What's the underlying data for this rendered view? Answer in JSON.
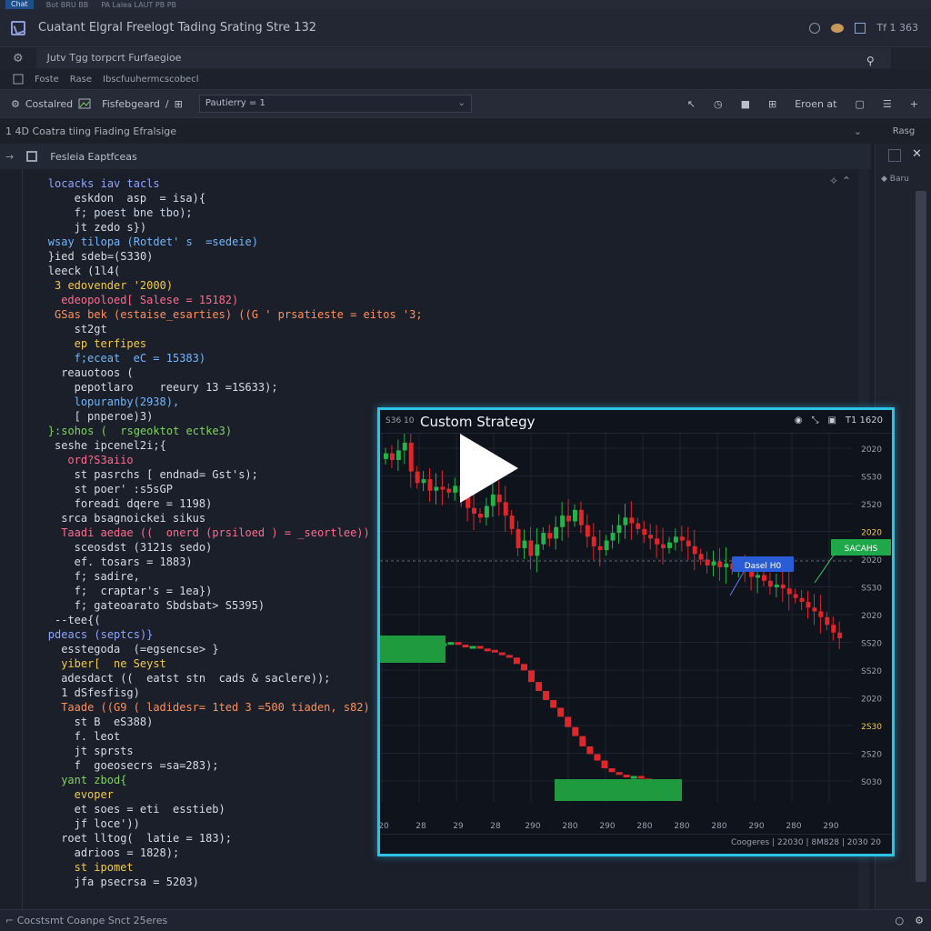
{
  "top_strip": {
    "items": [
      "Chat",
      "Bot BRU BB",
      "PA Lalea LAUT PB PB"
    ]
  },
  "window": {
    "title": "Cuatant Elgral Freelogt Tading Srating Stre 132",
    "right_label": "Tf 1 363"
  },
  "search_bar": {
    "value": "Jutv Tgg torpcrt  Furfaegioe"
  },
  "menu_row": {
    "items": [
      "Foste",
      "Rase",
      "Ibscfuuhermcscobecl"
    ]
  },
  "toolbar": {
    "item1": "Costalred",
    "item2": "Fisfebgeard",
    "select_value": "Pautierry = 1",
    "right_label": "Eroen at"
  },
  "section_header": {
    "label": "1 4D Coatra tiing Fiading Efralsige",
    "side_label": "Rasg"
  },
  "subheader": {
    "label": "Fesleia Eaptfceas"
  },
  "sidebar": {
    "label": "Baru"
  },
  "status_bar": {
    "label": "Cocstsmt Coanpe Snct 25eres"
  },
  "code": {
    "lines": [
      {
        "t": "locacks iav tacls",
        "c": "#8fa4ff",
        "i": 4
      },
      {
        "t": "eskdon  asp  = isa){",
        "c": "#d7dbe4",
        "i": 8
      },
      {
        "t": "f; poest bne tbo);",
        "c": "#c9d4e6",
        "i": 8
      },
      {
        "t": "jt zedo s})",
        "c": "#d7dbe4",
        "i": 8
      },
      {
        "t": "wsay tilopa (Rotdet' s  =sedeie)",
        "c": "#6fb7ff",
        "i": 4
      },
      {
        "t": "}ied sdeb=(S330)",
        "c": "#d7dbe4",
        "i": 4
      },
      {
        "t": "leeck (1l4(",
        "c": "#d7dbe4",
        "i": 4
      },
      {
        "t": "3 edovender '2000)",
        "c": "#f2c94c",
        "i": 5
      },
      {
        "t": "edeopoloed[ Salese = 15182)",
        "c": "#ff6a8c",
        "i": 6
      },
      {
        "t": "GSas bek (estaise_esarties) ((G ' prsatieste = eitos '3;",
        "c": "#ff8f5a",
        "i": 5
      },
      {
        "t": "st2gt",
        "c": "#d7dbe4",
        "i": 8
      },
      {
        "t": "ep terfipes",
        "c": "#f2c94c",
        "i": 8
      },
      {
        "t": "f;eceat  eC = 15383)",
        "c": "#6fb7ff",
        "i": 8
      },
      {
        "t": "reauotoos (",
        "c": "#d7dbe4",
        "i": 6
      },
      {
        "t": "pepotlaro    reeury 13 =1S633);",
        "c": "#d7dbe4",
        "i": 8
      },
      {
        "t": "lopuranby(2938),",
        "c": "#6fb7ff",
        "i": 8
      },
      {
        "t": "[ pnperoe)3)",
        "c": "#d7dbe4",
        "i": 8
      },
      {
        "t": "}:sohos (  rsgeoktot ectke3)",
        "c": "#7fd35f",
        "i": 4
      },
      {
        "t": "seshe ipcenel2i;{",
        "c": "#d7dbe4",
        "i": 5
      },
      {
        "t": "ord?S3aiio",
        "c": "#ff6a8c",
        "i": 7
      },
      {
        "t": "st pasrchs [ endnad= Gst's);",
        "c": "#d7dbe4",
        "i": 8
      },
      {
        "t": "st poer' :s5sGP",
        "c": "#d7dbe4",
        "i": 8
      },
      {
        "t": "foreadi dqere = 1198)",
        "c": "#d7dbe4",
        "i": 8
      },
      {
        "t": "srca bsagnoickei sikus",
        "c": "#d7dbe4",
        "i": 6
      },
      {
        "t": "Taadi aedae ((  onerd (prsiloed ) = _seortlee))",
        "c": "#ff6a8c",
        "i": 6
      },
      {
        "t": "sceosdst (3121s sedo)",
        "c": "#d7dbe4",
        "i": 8
      },
      {
        "t": "ef. tosars = 1883)",
        "c": "#d7dbe4",
        "i": 8
      },
      {
        "t": "f; sadire,",
        "c": "#d7dbe4",
        "i": 8
      },
      {
        "t": "f;  craptar's = 1ea})",
        "c": "#d7dbe4",
        "i": 8
      },
      {
        "t": "f; gateoarato Sbdsbat> S5395)",
        "c": "#d7dbe4",
        "i": 8
      },
      {
        "t": "--tee{(",
        "c": "#d7dbe4",
        "i": 5
      },
      {
        "t": "pdeacs (septcs)}",
        "c": "#8fa4ff",
        "i": 4
      },
      {
        "t": "esstegoda  (=egsencse> }",
        "c": "#d7dbe4",
        "i": 6
      },
      {
        "t": "yiber[  ne Seyst",
        "c": "#f2c94c",
        "i": 6
      },
      {
        "t": "adesdact ((  eatst stn  cads & saclere));",
        "c": "#d7dbe4",
        "i": 6
      },
      {
        "t": "1 dSfesfisg)",
        "c": "#d7dbe4",
        "i": 6
      },
      {
        "t": "Taade ((G9 ( ladidesr= 1ted 3 =500 tiaden, s82)",
        "c": "#ff8f5a",
        "i": 6
      },
      {
        "t": "st B  eS388)",
        "c": "#d7dbe4",
        "i": 8
      },
      {
        "t": "f. leot",
        "c": "#d7dbe4",
        "i": 8
      },
      {
        "t": "jt sprsts",
        "c": "#d7dbe4",
        "i": 8
      },
      {
        "t": "f  goeosecrs =sa=283);",
        "c": "#d7dbe4",
        "i": 8
      },
      {
        "t": "yant zbod{",
        "c": "#7fd35f",
        "i": 6
      },
      {
        "t": "evoper",
        "c": "#f2c94c",
        "i": 8
      },
      {
        "t": "et soes = eti  esstieb)",
        "c": "#d7dbe4",
        "i": 8
      },
      {
        "t": "jf loce'))",
        "c": "#d7dbe4",
        "i": 8
      },
      {
        "t": "roet lltog(  latie = 183);",
        "c": "#d7dbe4",
        "i": 6
      },
      {
        "t": "adrioos = 1828);",
        "c": "#d7dbe4",
        "i": 8
      },
      {
        "t": "st ipomet",
        "c": "#f2c94c",
        "i": 8
      },
      {
        "t": "jfa psecrsa = 5203)",
        "c": "#d7dbe4",
        "i": 8
      }
    ]
  },
  "chart_window": {
    "small_label": "S36 10",
    "title": "Custom Strategy",
    "header_right": "T1 1620",
    "footer_label": "Coogeres  |  22030  |  8M828  |  2030  20"
  },
  "chart_data": {
    "type": "candlestick",
    "title": "Custom Strategy",
    "y_tick_labels": [
      "2020",
      "SS30",
      "2520",
      "2020",
      "2020",
      "SS30",
      "2020",
      "SS20",
      "SS20",
      "2020",
      "2S30",
      "2S20",
      "S030"
    ],
    "highlighted_y_tick_index": 3,
    "x_tick_labels": [
      "20",
      "28",
      "29",
      "28",
      "290",
      "280",
      "290",
      "280",
      "280",
      "280",
      "290",
      "280",
      "290"
    ],
    "annotations": [
      {
        "label": "Dasel H0",
        "color": "#2a5cd6"
      },
      {
        "label": "SACAHS",
        "color": "#1fa84a"
      }
    ],
    "up_color": "#25b24a",
    "down_color": "#e0252b",
    "price_series": [
      21,
      28,
      18,
      10,
      40,
      52,
      48,
      60,
      56,
      58,
      62,
      55,
      66,
      78,
      84,
      88,
      76,
      64,
      72,
      86,
      100,
      120,
      112,
      128,
      116,
      104,
      110,
      98,
      86,
      92,
      80,
      96,
      108,
      118,
      122,
      112,
      104,
      96,
      88,
      94,
      100,
      106,
      110,
      116,
      120,
      114,
      108,
      112,
      118,
      126,
      132,
      138,
      134,
      140,
      136,
      142,
      138,
      144,
      150,
      148,
      154,
      160,
      158,
      162,
      168,
      172,
      176,
      182,
      186,
      192,
      200,
      208,
      214
    ],
    "lower_series": [
      250,
      252,
      255,
      254,
      256,
      258,
      260,
      262,
      258,
      256,
      260,
      264,
      262,
      266,
      268,
      272,
      276,
      280,
      290,
      300,
      318,
      332,
      346,
      358,
      372,
      388,
      402,
      418,
      430,
      440,
      452,
      458,
      462,
      466,
      464,
      468,
      470,
      472,
      474,
      472,
      476
    ]
  }
}
